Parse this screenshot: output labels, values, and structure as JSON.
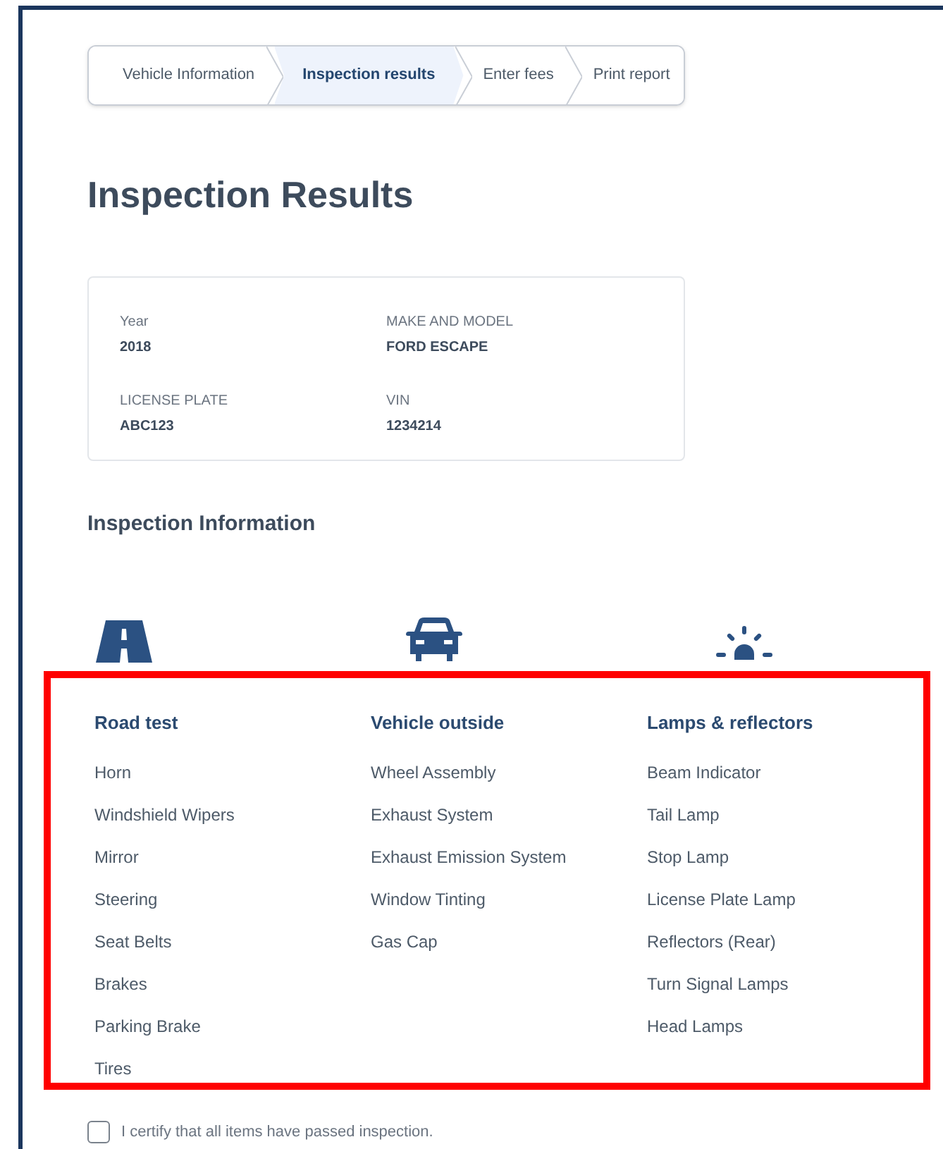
{
  "steps": [
    {
      "label": "Vehicle Information",
      "selected": false
    },
    {
      "label": "Inspection results",
      "selected": true
    },
    {
      "label": "Enter fees",
      "selected": false
    },
    {
      "label": "Print report",
      "selected": false
    }
  ],
  "title": "Inspection Results",
  "vehicle": [
    {
      "label": "Year",
      "value": "2018"
    },
    {
      "label": "MAKE AND MODEL",
      "value": "FORD ESCAPE"
    },
    {
      "label": "LICENSE PLATE",
      "value": "ABC123"
    },
    {
      "label": "VIN",
      "value": "1234214"
    }
  ],
  "section_title": "Inspection Information",
  "categories_highlighted": true,
  "categories": [
    {
      "kind": "road",
      "title": "Road test",
      "items": [
        "Horn",
        "Windshield Wipers",
        "Mirror",
        "Steering",
        "Seat Belts",
        "Brakes",
        "Parking Brake",
        "Tires"
      ]
    },
    {
      "kind": "car",
      "title": "Vehicle outside",
      "items": [
        "Wheel Assembly",
        "Exhaust System",
        "Exhaust Emission System",
        "Window Tinting",
        "Gas Cap"
      ]
    },
    {
      "kind": "lamp",
      "title": "Lamps & reflectors",
      "items": [
        "Beam Indicator",
        "Tail Lamp",
        "Stop Lamp",
        "License Plate Lamp",
        "Reflectors (Rear)",
        "Turn Signal Lamps",
        "Head Lamps"
      ]
    }
  ],
  "certify": {
    "label": "I certify that all items have passed inspection.",
    "checked": false
  }
}
